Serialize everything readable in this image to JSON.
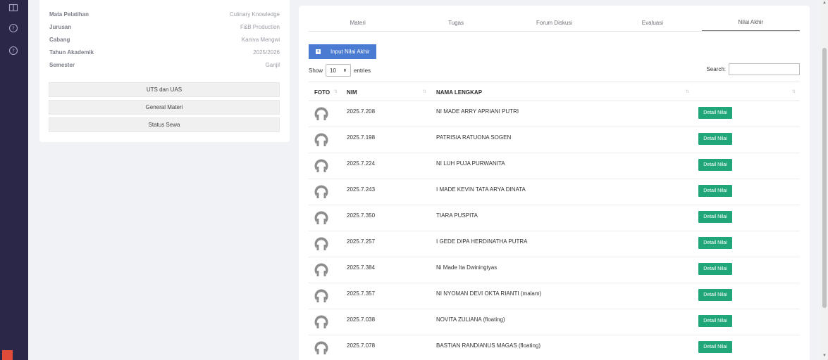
{
  "sidebar_icons": [
    "book-icon",
    "help-circle-icon",
    "help-circle-icon"
  ],
  "info": [
    {
      "label": "Mata Pelatihan",
      "value": "Culinary Knowledge"
    },
    {
      "label": "Jurusan",
      "value": "F&B Production"
    },
    {
      "label": "Cabang",
      "value": "Kaniva Mengwi"
    },
    {
      "label": "Tahun Akademik",
      "value": "2025/2026"
    },
    {
      "label": "Semester",
      "value": "Ganjil"
    }
  ],
  "left_buttons": [
    "UTS dan UAS",
    "General Materi",
    "Status Sewa"
  ],
  "tabs": [
    "Materi",
    "Tugas",
    "Forum Diskusi",
    "Evaluasi",
    "Nilai Akhir"
  ],
  "active_tab": "Nilai Akhir",
  "input_button": "Input Nilai Akhir",
  "show_label": "Show",
  "entries_value": "10",
  "entries_label": "entries",
  "search_label": "Search:",
  "table": {
    "headers": {
      "foto": "FOTO",
      "nim": "NIM",
      "nama": "NAMA LENGKAP"
    },
    "detail_label": "Detail Nilai",
    "rows": [
      {
        "nim": "2025.7.208",
        "nama": "NI MADE ARRY APRIANI PUTRI"
      },
      {
        "nim": "2025.7.198",
        "nama": "PATRISIA RATUONA SOGEN"
      },
      {
        "nim": "2025.7.224",
        "nama": "NI LUH PUJA PURWANITA"
      },
      {
        "nim": "2025.7.243",
        "nama": "I MADE KEVIN TATA ARYA DINATA"
      },
      {
        "nim": "2025.7.350",
        "nama": "TIARA PUSPITA"
      },
      {
        "nim": "2025.7.257",
        "nama": "I GEDE DIPA HERDINATHA PUTRA"
      },
      {
        "nim": "2025.7.384",
        "nama": "Ni Made Ita Dwiningtyas"
      },
      {
        "nim": "2025.7.357",
        "nama": "NI NYOMAN DEVI OKTA RIANTI (malam)"
      },
      {
        "nim": "2025.7.038",
        "nama": "NOVITA ZULIANA (floating)"
      },
      {
        "nim": "2025.7.078",
        "nama": "BASTIAN RANDIANUS MAGAS (floating)"
      }
    ]
  },
  "colors": {
    "sidebar": "#2b2748",
    "primary": "#4a7bd2",
    "success": "#21a67a"
  }
}
